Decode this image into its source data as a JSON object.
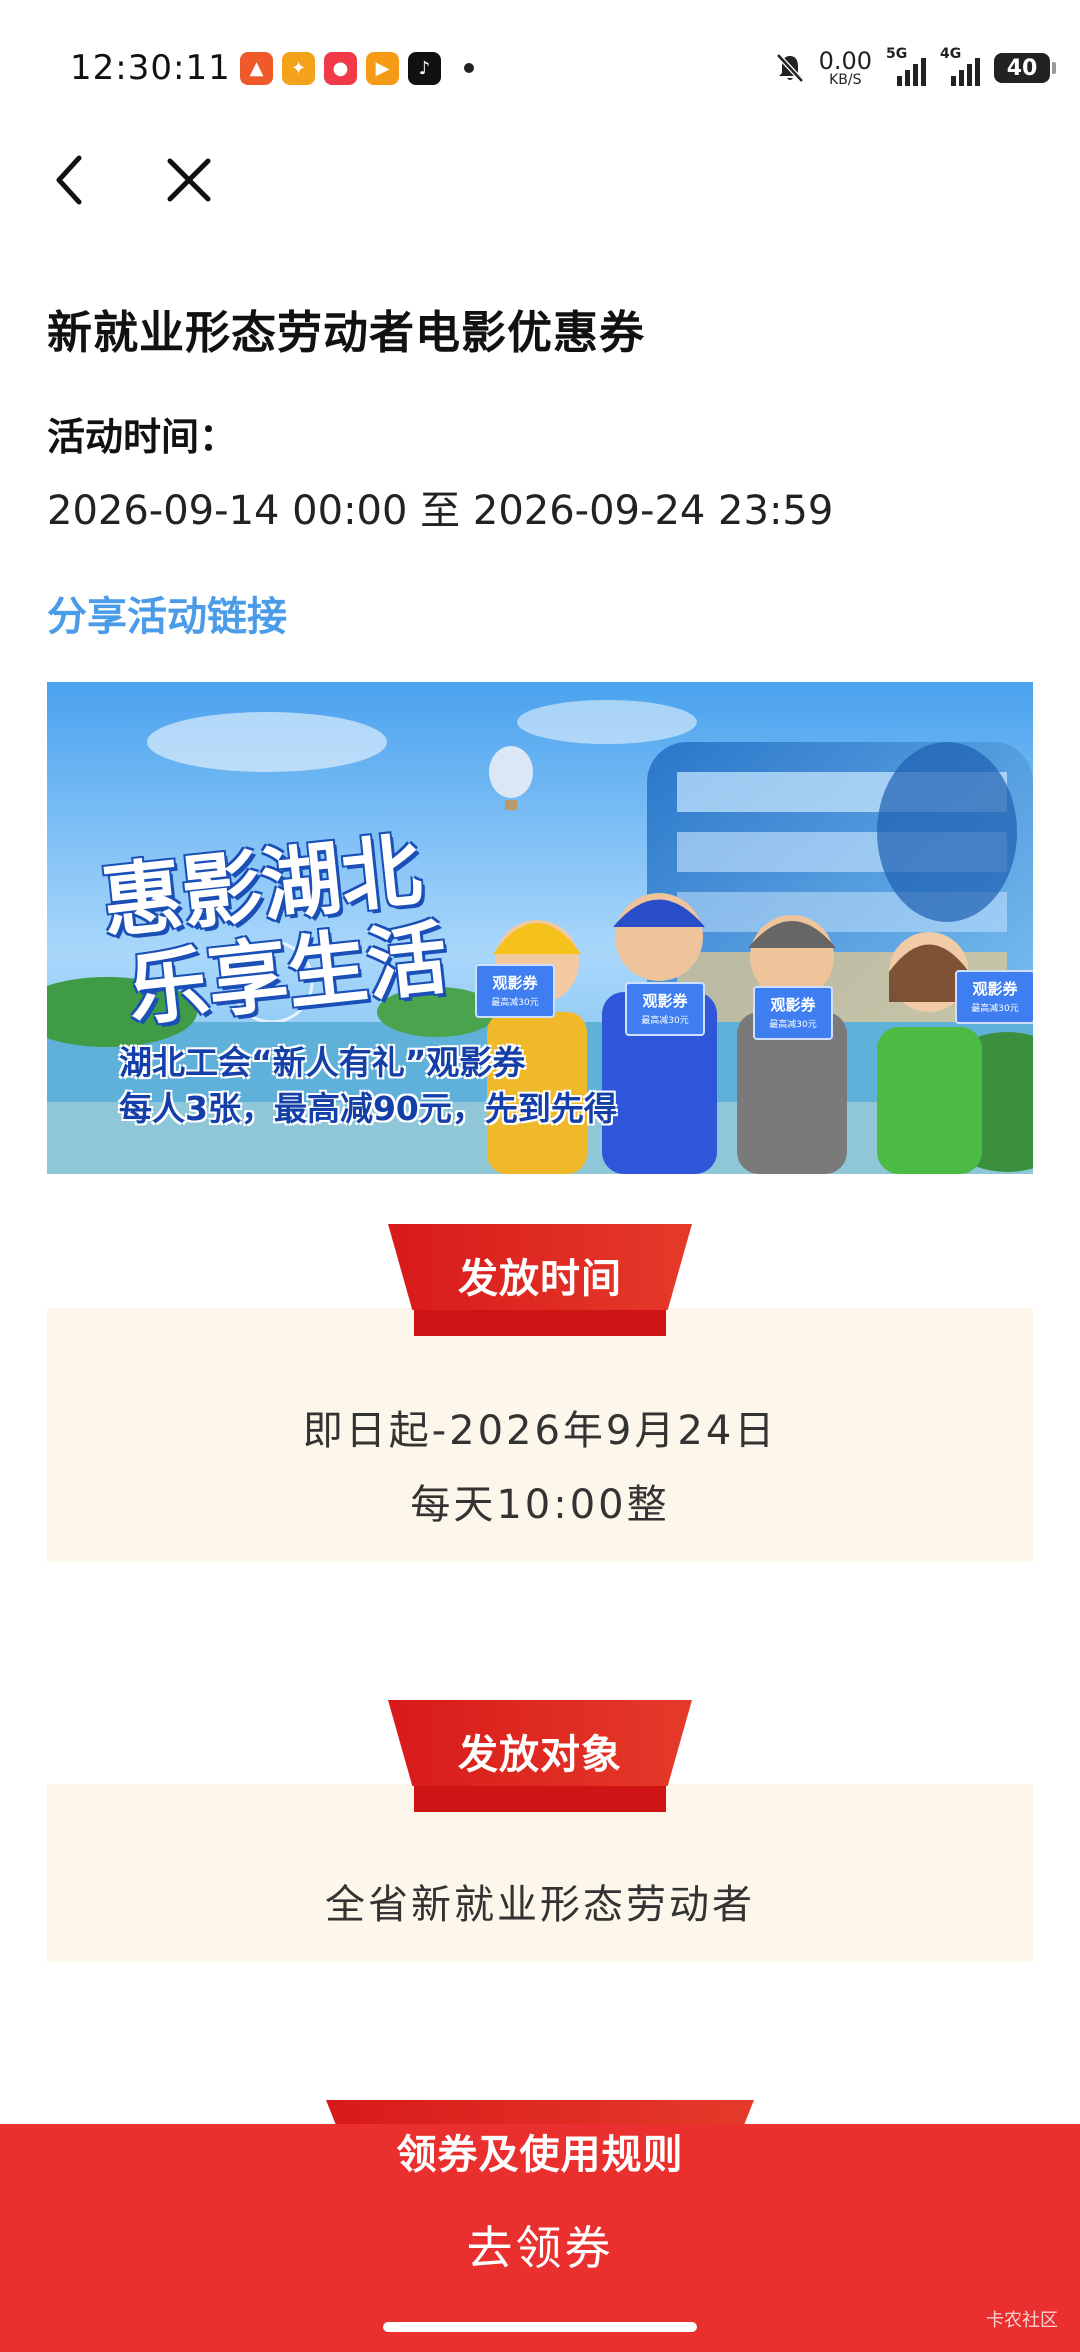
{
  "status_bar": {
    "time": "12:30:11",
    "net_speed_value": "0.00",
    "net_speed_unit": "KB/S",
    "signal1_label": "5G",
    "signal2_label": "4G",
    "battery": "40",
    "apps": [
      {
        "icon": "rocket-app-icon",
        "color": "#ee5a2a"
      },
      {
        "icon": "star-app-icon",
        "color": "#f4a21a"
      },
      {
        "icon": "red-envelope-app-icon",
        "color": "#f03a4a"
      },
      {
        "icon": "video-app-icon",
        "color": "#f59b17"
      },
      {
        "icon": "tiktok-app-icon",
        "color": "#111111"
      }
    ]
  },
  "page": {
    "title": "新就业形态劳动者电影优惠券",
    "time_label": "活动时间：",
    "time_range": "2026-09-14 00:00 至 2026-09-24 23:59",
    "share_link": "分享活动链接"
  },
  "banner": {
    "headline1": "惠影湖北",
    "headline2": "乐享生活",
    "subline1": "湖北工会“新人有礼”观影券",
    "subline2": "每人3张，最高减90元，先到先得",
    "ticket_title": "观影券",
    "ticket_sub": "最高减30元"
  },
  "sections": {
    "issue_time": {
      "title": "发放时间",
      "line1": "即日起-2026年9月24日",
      "line2": "每天10:00整"
    },
    "target": {
      "title": "发放对象",
      "line1": "全省新就业形态劳动者"
    },
    "rules": {
      "title": "领券及使用规则"
    }
  },
  "bottom": {
    "claim_button": "去领券",
    "watermark": "卡农社区"
  },
  "colors": {
    "accent_red": "#ea2f2f",
    "link_blue": "#4a9be8",
    "section_bg": "#fdf6ea"
  }
}
